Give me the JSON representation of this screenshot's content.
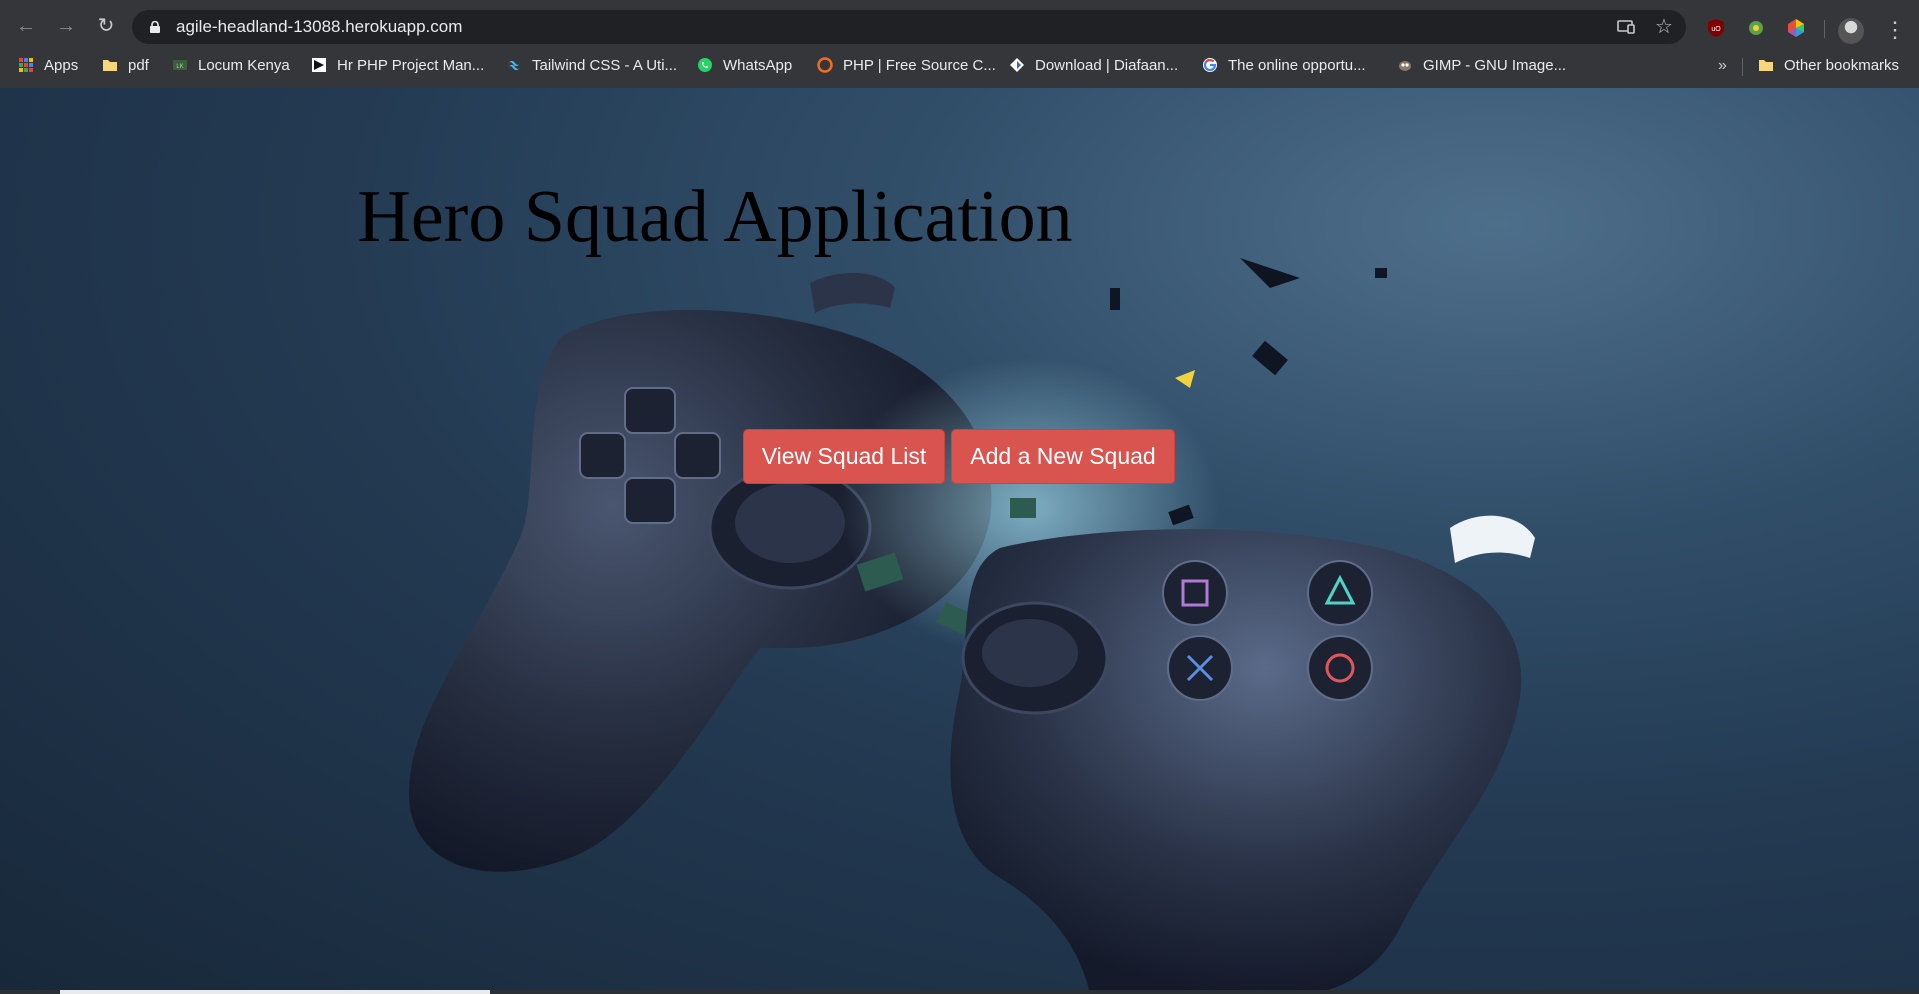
{
  "browser": {
    "url": "agile-headland-13088.herokuapp.com",
    "bookmarks": [
      {
        "label": "Apps",
        "icon": "apps-grid-icon"
      },
      {
        "label": "pdf",
        "icon": "folder-icon"
      },
      {
        "label": "Locum Kenya",
        "icon": "site-favicon"
      },
      {
        "label": "Hr PHP Project Man...",
        "icon": "site-favicon"
      },
      {
        "label": "Tailwind CSS - A Uti...",
        "icon": "tailwind-icon"
      },
      {
        "label": "WhatsApp",
        "icon": "whatsapp-icon"
      },
      {
        "label": "PHP | Free Source C...",
        "icon": "site-favicon"
      },
      {
        "label": "Download | Diafaan...",
        "icon": "site-favicon"
      },
      {
        "label": "The online opportu...",
        "icon": "google-icon"
      },
      {
        "label": "GIMP - GNU Image...",
        "icon": "gimp-icon"
      }
    ],
    "overflow_glyph": "»",
    "other_bookmarks_label": "Other bookmarks"
  },
  "page": {
    "title": "Hero Squad Application",
    "buttons": {
      "view_squad_list": "View Squad List",
      "add_new_squad": "Add a New Squad"
    }
  },
  "colors": {
    "chrome_bg": "#35363a",
    "omnibox_bg": "#202124",
    "button_bg": "#d9534f",
    "page_bg": "#233a52"
  }
}
